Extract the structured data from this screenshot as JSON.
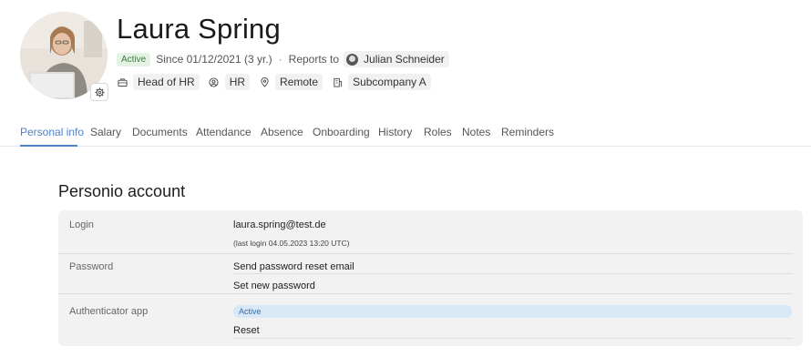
{
  "profile": {
    "name": "Laura Spring",
    "status": "Active",
    "since": "Since 01/12/2021 (3 yr.)",
    "separator": "·",
    "reports_to_label": "Reports to",
    "manager": "Julian Schneider"
  },
  "tags": [
    {
      "icon": "briefcase-icon",
      "label": "Head of HR"
    },
    {
      "icon": "user-circle-icon",
      "label": "HR"
    },
    {
      "icon": "location-pin-icon",
      "label": "Remote"
    },
    {
      "icon": "building-icon",
      "label": "Subcompany A"
    }
  ],
  "tabs": [
    {
      "label": "Personal info",
      "active": true
    },
    {
      "label": "Salary"
    },
    {
      "label": "Documents"
    },
    {
      "label": "Attendance"
    },
    {
      "label": "Absence"
    },
    {
      "label": "Onboarding"
    },
    {
      "label": "History"
    },
    {
      "label": "Roles"
    },
    {
      "label": "Notes"
    },
    {
      "label": "Reminders"
    }
  ],
  "colors": {
    "accent": "#4e82c9",
    "active_badge": "#e4f3e4",
    "card_bg": "#f2f2f2"
  },
  "account": {
    "title": "Personio account",
    "login": {
      "label": "Login",
      "email": "laura.spring@test.de",
      "last_login": "(last login 04.05.2023 13:20 UTC)"
    },
    "password": {
      "label": "Password",
      "reset_email": "Send password reset email",
      "set_new": "Set new password"
    },
    "authenticator": {
      "label": "Authenticator app",
      "status": "Active",
      "reset": "Reset"
    }
  }
}
